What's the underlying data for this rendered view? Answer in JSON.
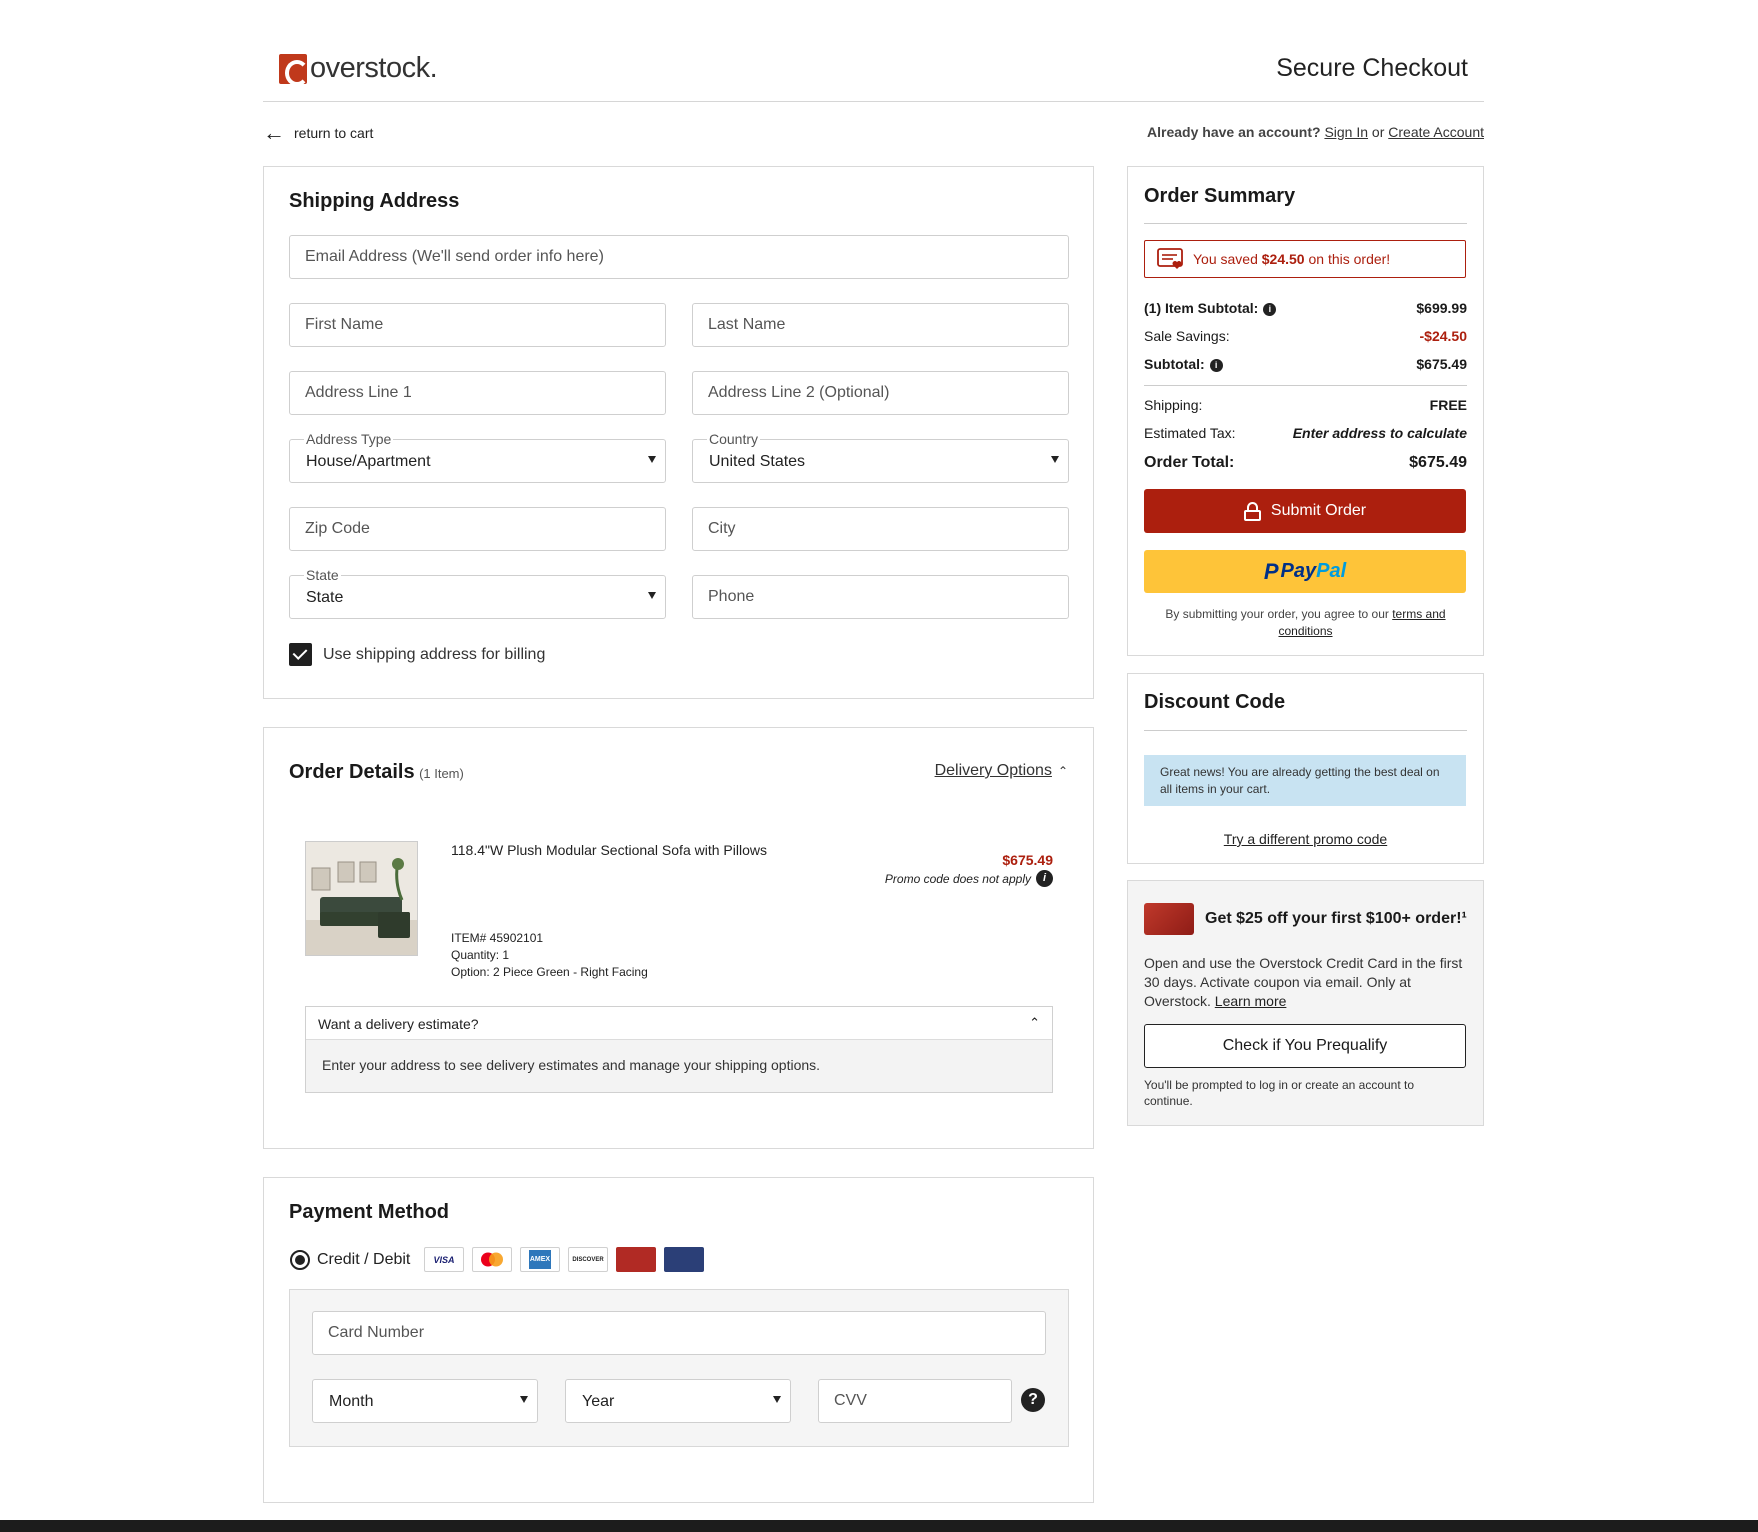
{
  "header": {
    "logo_text": "overstock.",
    "title": "Secure Checkout"
  },
  "nav": {
    "return_label": "return to cart",
    "account_prompt": "Already have an account?",
    "sign_in": "Sign In",
    "or": "or",
    "create_account": "Create Account"
  },
  "shipping": {
    "title": "Shipping Address",
    "email_placeholder": "Email Address (We'll send order info here)",
    "first_name_placeholder": "First Name",
    "last_name_placeholder": "Last Name",
    "address1_placeholder": "Address Line 1",
    "address2_placeholder": "Address Line 2 (Optional)",
    "address_type_label": "Address Type",
    "address_type_value": "House/Apartment",
    "country_label": "Country",
    "country_value": "United States",
    "zip_placeholder": "Zip Code",
    "city_placeholder": "City",
    "state_label": "State",
    "state_value": "State",
    "phone_placeholder": "Phone",
    "billing_checkbox_label": "Use shipping address for billing",
    "billing_checked": true
  },
  "order_details": {
    "title": "Order Details",
    "count": "(1 Item)",
    "delivery_options": "Delivery Options",
    "item": {
      "name": "118.4\"W Plush Modular Sectional Sofa with Pillows",
      "price": "$675.49",
      "promo_note": "Promo code does not apply",
      "item_number": "ITEM# 45902101",
      "quantity": "Quantity: 1",
      "option": "Option: 2 Piece Green - Right Facing"
    },
    "delivery_estimate_title": "Want a delivery estimate?",
    "delivery_estimate_text": "Enter your address to see delivery estimates and manage your shipping options."
  },
  "payment": {
    "title": "Payment Method",
    "method_label": "Credit / Debit",
    "card_logos": [
      "VISA",
      "mastercard",
      "AMEX",
      "DISCOVER",
      "overstock",
      "card"
    ],
    "card_number_placeholder": "Card Number",
    "month_value": "Month",
    "year_value": "Year",
    "cvv_placeholder": "CVV",
    "help_symbol": "?"
  },
  "summary": {
    "title": "Order Summary",
    "savings_banner_prefix": "You saved ",
    "savings_amount": "$24.50",
    "savings_banner_suffix": " on this order!",
    "rows": [
      {
        "label": "(1) Item Subtotal:",
        "value": "$699.99"
      },
      {
        "label": "Sale Savings:",
        "value": "-$24.50"
      },
      {
        "label": "Subtotal:",
        "value": "$675.49"
      },
      {
        "label": "Shipping:",
        "value": "FREE"
      },
      {
        "label": "Estimated Tax:",
        "value": "Enter address to calculate"
      }
    ],
    "total_label": "Order Total:",
    "total_value": "$675.49",
    "submit_label": "Submit Order",
    "paypal_pay": "Pay",
    "paypal_pal": "Pal",
    "terms_prefix": "By submitting your order, you agree to our ",
    "terms_link": "terms and conditions",
    "accent_color": "#ac1f0e",
    "paypal_color": "#fec439"
  },
  "discount": {
    "title": "Discount Code",
    "notice": "Great news! You are already getting the best deal on all items in your cart.",
    "try_link": "Try a different promo code"
  },
  "credit": {
    "headline": "Get $25 off your first $100+ order!¹",
    "body": "Open and use the Overstock Credit Card in the first 30 days. Activate coupon via email. Only at Overstock.",
    "learn_more": "Learn more",
    "prequalify_label": "Check if You Prequalify",
    "footnote": "You'll be prompted to log in or create an account to continue."
  }
}
